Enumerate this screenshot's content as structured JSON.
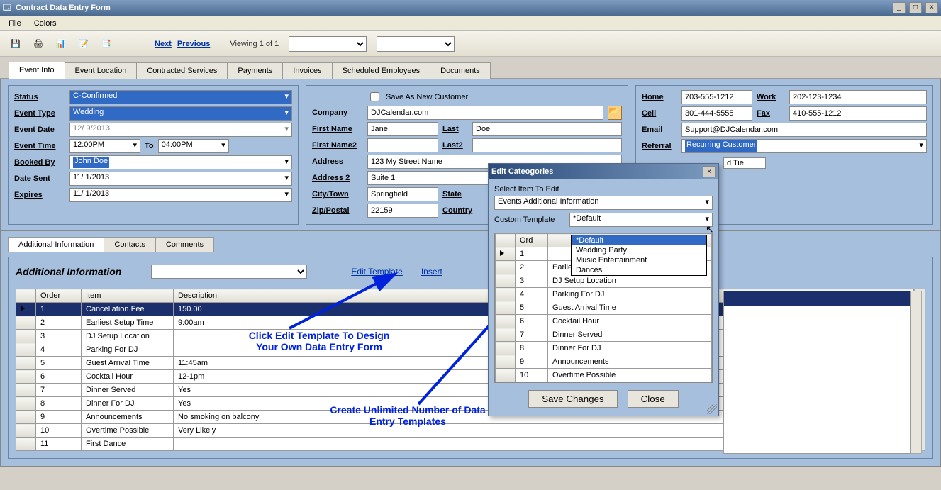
{
  "window": {
    "title": "Contract Data Entry Form"
  },
  "menu": {
    "file": "File",
    "colors": "Colors"
  },
  "nav": {
    "next": "Next",
    "previous": "Previous",
    "viewing": "Viewing 1 of 1"
  },
  "tabs": [
    "Event Info",
    "Event Location",
    "Contracted Services",
    "Payments",
    "Invoices",
    "Scheduled Employees",
    "Documents"
  ],
  "left": {
    "label_status": "Status",
    "status": "C-Confirmed",
    "label_event_type": "Event Type",
    "event_type": "Wedding",
    "label_event_date": "Event Date",
    "event_date": "12/  9/2013",
    "label_event_time": "Event Time",
    "time_from": "12:00PM",
    "label_to": "To",
    "time_to": "04:00PM",
    "label_booked_by": "Booked By",
    "booked_by": "John Doe",
    "label_date_sent": "Date Sent",
    "date_sent": "11/  1/2013",
    "label_expires": "Expires",
    "expires": "11/  1/2013"
  },
  "mid": {
    "save_as_new": "Save As New Customer",
    "label_company": "Company",
    "company": "DJCalendar.com",
    "label_first": "First Name",
    "first": "Jane",
    "label_last": "Last",
    "last": "Doe",
    "label_first2": "First Name2",
    "first2": "",
    "label_last2": "Last2",
    "last2": "",
    "label_address": "Address",
    "address": "123 My Street Name",
    "label_address2": "Address 2",
    "address2": "Suite 1",
    "label_city": "City/Town",
    "city": "Springfield",
    "label_state": "State",
    "label_zip": "Zip/Postal",
    "zip": "22159",
    "label_country": "Country"
  },
  "right": {
    "label_home": "Home",
    "home": "703-555-1212",
    "label_work": "Work",
    "work": "202-123-1234",
    "label_cell": "Cell",
    "cell": "301-444-5555",
    "label_fax": "Fax",
    "fax": "410-555-1212",
    "label_email": "Email",
    "email": "Support@DJCalendar.com",
    "label_referral": "Referral",
    "referral": "Recurring Customer",
    "tie": "d Tie"
  },
  "subtabs": [
    "Additional Information",
    "Contacts",
    "Comments"
  ],
  "ai": {
    "title": "Additional Information",
    "edit_template": "Edit Template",
    "insert": "Insert",
    "cols": {
      "order": "Order",
      "item": "Item",
      "desc": "Description"
    },
    "rows": [
      {
        "order": "1",
        "item": "Cancellation Fee",
        "desc": "150.00"
      },
      {
        "order": "2",
        "item": "Earliest Setup Time",
        "desc": "9:00am"
      },
      {
        "order": "3",
        "item": "DJ Setup Location",
        "desc": ""
      },
      {
        "order": "4",
        "item": "Parking For DJ",
        "desc": ""
      },
      {
        "order": "5",
        "item": "Guest Arrival Time",
        "desc": "11:45am"
      },
      {
        "order": "6",
        "item": "Cocktail Hour",
        "desc": "12-1pm"
      },
      {
        "order": "7",
        "item": "Dinner Served",
        "desc": "Yes"
      },
      {
        "order": "8",
        "item": "Dinner For DJ",
        "desc": "Yes"
      },
      {
        "order": "9",
        "item": "Announcements",
        "desc": "No smoking on balcony"
      },
      {
        "order": "10",
        "item": "Overtime Possible",
        "desc": "Very Likely"
      },
      {
        "order": "11",
        "item": "First Dance",
        "desc": ""
      }
    ]
  },
  "dialog": {
    "title": "Edit Cateogories",
    "select_label": "Select Item To Edit",
    "select_value": "Events Additional Information",
    "template_label": "Custom Template",
    "template_value": "*Default",
    "options": [
      "*Default",
      "Wedding Party",
      "Music Entertainment",
      "Dances"
    ],
    "col_ord": "Ord",
    "rows": [
      {
        "o": "1",
        "i": ""
      },
      {
        "o": "2",
        "i": "Earliest Setup Time"
      },
      {
        "o": "3",
        "i": "DJ Setup Location"
      },
      {
        "o": "4",
        "i": "Parking For DJ"
      },
      {
        "o": "5",
        "i": "Guest Arrival Time"
      },
      {
        "o": "6",
        "i": "Cocktail Hour"
      },
      {
        "o": "7",
        "i": "Dinner Served"
      },
      {
        "o": "8",
        "i": "Dinner For DJ"
      },
      {
        "o": "9",
        "i": "Announcements"
      },
      {
        "o": "10",
        "i": "Overtime Possible"
      }
    ],
    "save": "Save Changes",
    "close": "Close"
  },
  "annotations": {
    "a1": "Click Edit Template To Design\nYour Own Data Entry Form",
    "a2": "Create Unlimited Number of Data\nEntry Templates"
  }
}
